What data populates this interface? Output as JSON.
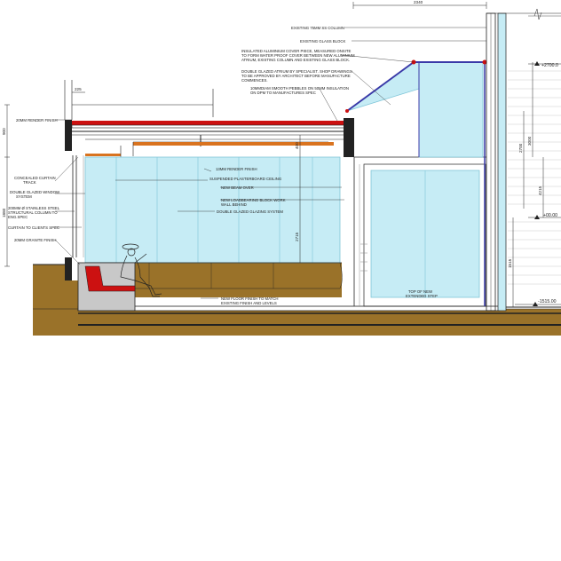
{
  "drawing": {
    "title": "",
    "notes_top": {
      "col75": "EXISTING 75MM SS COLUMN",
      "glassblock": "EXISTING GLASS BLOCK",
      "alum1": "INSULATED ALUMINIUM COVER PIECE, MEASURED ONSITE",
      "alum2": "TO FORM WATER PROOF COVER BETWEEN NEW ALUMINIUM",
      "alum3": "ATRIUM, EXISTING COLUMN AND EXISTING GLASS BLOCK.",
      "atrium1": "DOUBLE GLAZED ATRIUM BY SPECIALIST. SHOP DRAWINGS",
      "atrium2": "TO BE APPROVED BY ARCHITECT BEFORE MANUFACTURE",
      "atrium3": "COMMENCES.",
      "pebbles1": "10MMDIAM SMOOTH PEBBLES ON 50MM INSULATION",
      "pebbles2": "ON DPM TO MANUFACTURES SPEC"
    },
    "notes_left": {
      "render20": "20MM RENDER FINISH",
      "curtain1": "CONCEALED CURTAIN",
      "curtain2": "TRACK",
      "window1": "DOUBLE GLAZED WINDOW",
      "window2": "SYSTEM",
      "steel1": "200MM Ø STAINLESS STEEL",
      "steel2": "STRUCTURAL COLUMN TO",
      "steel3": "ENG.SPEC",
      "curtains_spec": "CURTAIN TO CLIENTS SPEC",
      "granite": "20MM GRANITE FINISH"
    },
    "notes_mid": {
      "render13": "13MM RENDER FINISH",
      "ceiling": "SUSPENDED PLASTERBOARD CEILING",
      "beam": "NEW BEAM OVER",
      "block1": "NEW LOADBEARING BLOCK WORK",
      "block2": "WALL BEHIND",
      "glazing": "DOUBLE GLAZED GLAZING SYSTEM",
      "floor1": "NEW FLOOR FINISH TO MATCH",
      "floor2": "EXISTING FINISH AND LEVELS",
      "step1": "TOP OF NEW",
      "step2": "EXTENDED STEP"
    },
    "dimensions": {
      "top_width": "2340",
      "d225": "225",
      "d900": "900",
      "d400": "400",
      "d1880": "1880",
      "d2715": "2715",
      "d3000": "3000",
      "d2700": "2700",
      "d4215": "4215",
      "d1515": "1515"
    },
    "levels": {
      "upper": "+2700.0",
      "ground": "+00.00",
      "lower": "-1515.00"
    },
    "colors": {
      "glass": "#c6ecf5",
      "glass_edge": "#7fc6d8",
      "earth": "#9a7229",
      "red_element": "#cc1111",
      "orange_beam": "#d9731f",
      "atrium_frame": "#3a3aa8",
      "wall_dark": "#222222",
      "step_grey": "#c8c8c8"
    }
  }
}
